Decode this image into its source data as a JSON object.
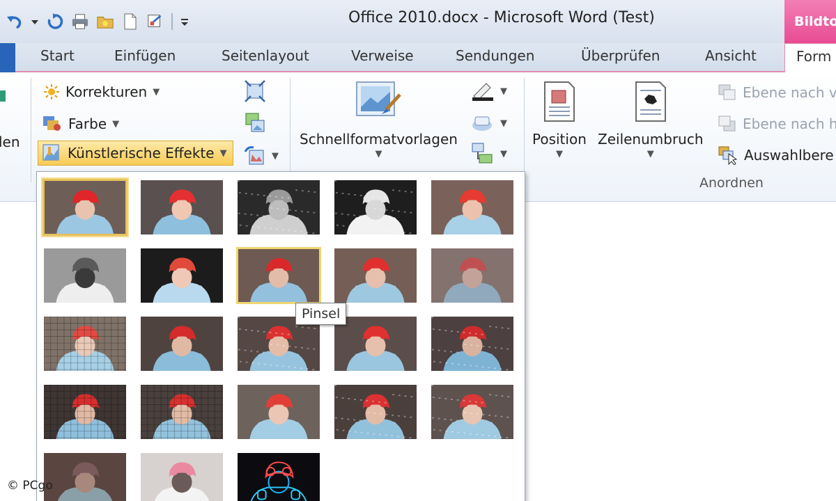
{
  "window": {
    "title": "Office 2010.docx - Microsoft Word (Test)",
    "context_tab": "Bildto"
  },
  "tabs": {
    "start": "Start",
    "einfuegen": "Einfügen",
    "seitenlayout": "Seitenlayout",
    "verweise": "Verweise",
    "sendungen": "Sendungen",
    "ueberpruefen": "Überprüfen",
    "ansicht": "Ansicht",
    "format": "Form"
  },
  "ribbon": {
    "left_cut_label": "len",
    "korrekturen": "Korrekturen",
    "farbe": "Farbe",
    "kuenstlerische_effekte": "Künstlerische Effekte",
    "schnellformatvorlagen": "Schnellformatvorlagen",
    "position": "Position",
    "zeilenumbruch": "Zeilenumbruch",
    "ebene_nach_vorne": "Ebene nach v",
    "ebene_nach_hinten": "Ebene nach h",
    "auswahlbereich": "Auswahlbere",
    "group_anordnen": "Anordnen"
  },
  "gallery": {
    "tooltip": "Pinsel",
    "selected_index": 0,
    "hover_index": 7,
    "effects": [
      "none",
      "markierung",
      "bleistift-graustufen",
      "bleistift-skizze",
      "linien",
      "kreide",
      "glasbild",
      "pinsel",
      "glimmer",
      "weichzeichner",
      "mosaik",
      "film",
      "zement",
      "textur",
      "kreuzschraffur",
      "pastell",
      "plastik",
      "leuchtende-kanten",
      "foto",
      "licht",
      "neon",
      "strich",
      "pastell-glatt"
    ]
  },
  "colors": {
    "accent_pink": "#e84b93",
    "file_blue": "#2a64b8",
    "highlight_yellow": "#f8cc55"
  },
  "watermark": "© PCgo"
}
